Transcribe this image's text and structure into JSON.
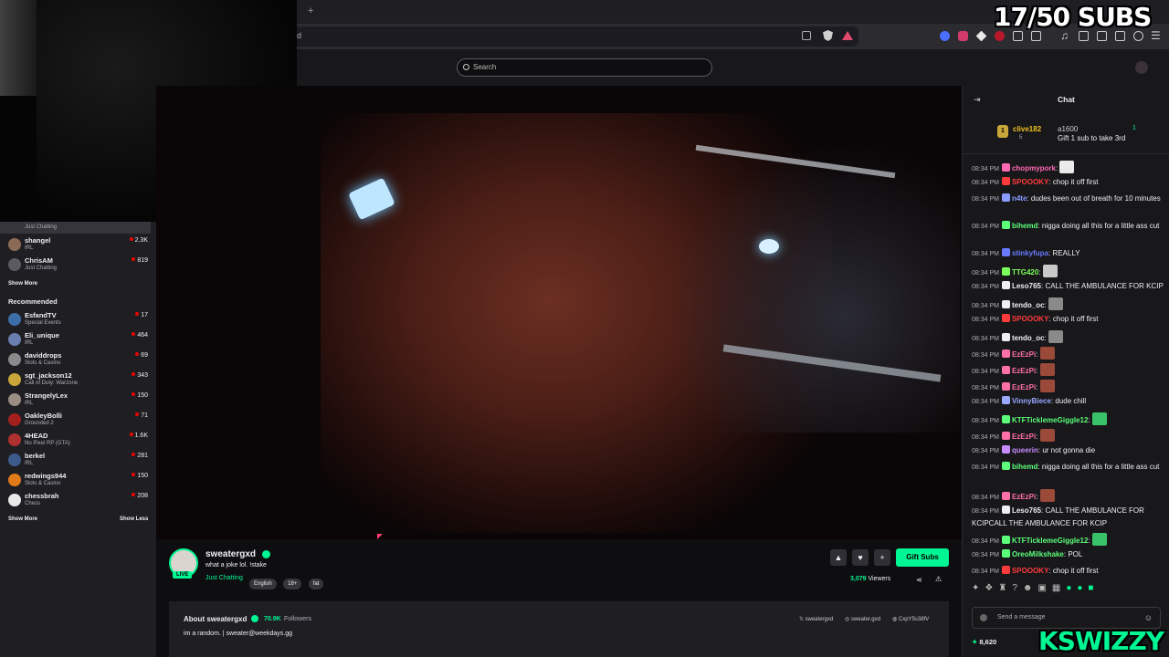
{
  "overlay": {
    "subs_goal": "17/50 SUBS",
    "streamer_logo": "KSWIZZY"
  },
  "browser": {
    "new_tab": "+",
    "url_tail": "d"
  },
  "header": {
    "search_placeholder": "Search"
  },
  "sidebar": {
    "top_channels": [
      {
        "game": "Just Chatting"
      },
      {
        "name": "shangel",
        "game": "IRL",
        "viewers": "2.3K"
      },
      {
        "name": "ChrisAM",
        "game": "Just Chatting",
        "viewers": "819"
      }
    ],
    "show_more_1": "Show More",
    "recommended_title": "Recommended",
    "recommended": [
      {
        "name": "EsfandTV",
        "game": "Special Events",
        "viewers": "17"
      },
      {
        "name": "Eli_unique",
        "game": "IRL",
        "viewers": "464"
      },
      {
        "name": "daviddrops",
        "game": "Slots & Casino",
        "viewers": "69"
      },
      {
        "name": "sgt_jackson12",
        "game": "Call of Duty: Warzone",
        "viewers": "343"
      },
      {
        "name": "StrangelyLex",
        "game": "IRL",
        "viewers": "150"
      },
      {
        "name": "OakleyBolli",
        "game": "Grounded 2",
        "viewers": "71"
      },
      {
        "name": "4HEAD",
        "game": "No Pixel RP (GTA)",
        "viewers": "1.6K"
      },
      {
        "name": "berkel",
        "game": "IRL",
        "viewers": "281"
      },
      {
        "name": "redwings944",
        "game": "Slots & Casino",
        "viewers": "150"
      },
      {
        "name": "chessbrah",
        "game": "Chess",
        "viewers": "208"
      }
    ],
    "show_more_2": "Show More",
    "show_less": "Show Less"
  },
  "stream": {
    "live_badge": "LIVE",
    "channel": "sweatergxd",
    "title": "what a joke lol. !stake",
    "category": "Just Chatting",
    "tags": [
      "English",
      "18+",
      "fat"
    ],
    "gift_subs": "Gift Subs",
    "viewers": "3,079",
    "viewers_label": "Viewers"
  },
  "about": {
    "heading": "About sweatergxd",
    "followers": "70.9K",
    "followers_label": "Followers",
    "bio": "im a random. | sweater@weekdays.gg",
    "socials": [
      "sweatergxd",
      "sweater.gxd",
      "CxpY5s38fV"
    ]
  },
  "chat": {
    "title": "Chat",
    "leaderboard": [
      {
        "rank": "1",
        "name": "clive182",
        "sub": "5"
      },
      {
        "name": "a1600",
        "gift_count": "1",
        "note": "Gift 1 sub to take 3rd"
      }
    ],
    "messages": [
      {
        "time": "08:34 PM",
        "user": "chopmypork",
        "color": "#ff69b4",
        "text": ""
      },
      {
        "time": "08:34 PM",
        "user": "SPOOOKY",
        "color": "#ff3b3b",
        "text": "chop it off first"
      },
      {
        "time": "08:34 PM",
        "user": "n4te",
        "color": "#8a9cff",
        "text": "dudes been out of breath for 10 minutes"
      },
      {
        "time": "08:34 PM",
        "user": "bihemd",
        "color": "#5cff7a",
        "text": "nigga doing all this for a little ass cut"
      },
      {
        "time": "08:34 PM",
        "user": "stinkyfupa",
        "color": "#6a7aff",
        "text": "REALLY"
      },
      {
        "time": "08:34 PM",
        "user": "TTG420",
        "color": "#7cff5a",
        "text": ""
      },
      {
        "time": "08:34 PM",
        "user": "Leso765",
        "color": "#efeff1",
        "text": "CALL THE AMBULANCE FOR KCIP"
      },
      {
        "time": "08:34 PM",
        "user": "tendo_oc",
        "color": "#efeff1",
        "text": ""
      },
      {
        "time": "08:34 PM",
        "user": "SPOOOKY",
        "color": "#ff3b3b",
        "text": "chop it off first"
      },
      {
        "time": "08:34 PM",
        "user": "tendo_oc",
        "color": "#efeff1",
        "text": ""
      },
      {
        "time": "08:34 PM",
        "user": "EzEzPi",
        "color": "#ff6fa8",
        "text": ""
      },
      {
        "time": "08:34 PM",
        "user": "EzEzPi",
        "color": "#ff6fa8",
        "text": ""
      },
      {
        "time": "08:34 PM",
        "user": "EzEzPi",
        "color": "#ff6fa8",
        "text": ""
      },
      {
        "time": "08:34 PM",
        "user": "VinnyBiece",
        "color": "#9aa8ff",
        "text": "dude chill"
      },
      {
        "time": "08:34 PM",
        "user": "KTFTicklemeGiggle12",
        "color": "#5cff7a",
        "text": ""
      },
      {
        "time": "08:34 PM",
        "user": "EzEzPi",
        "color": "#ff6fa8",
        "text": ""
      },
      {
        "time": "08:34 PM",
        "user": "queerin",
        "color": "#c78bff",
        "text": "ur not gonna die"
      },
      {
        "time": "08:34 PM",
        "user": "bihemd",
        "color": "#5cff7a",
        "text": "nigga doing all this for a little ass cut"
      },
      {
        "time": "08:34 PM",
        "user": "EzEzPi",
        "color": "#ff6fa8",
        "text": ""
      },
      {
        "time": "08:34 PM",
        "user": "Leso765",
        "color": "#efeff1",
        "text": "CALL THE AMBULANCE FOR KCIPCALL THE AMBULANCE FOR KCIP"
      },
      {
        "time": "08:34 PM",
        "user": "KTFTicklemeGiggle12",
        "color": "#5cff7a",
        "text": ""
      },
      {
        "time": "08:34 PM",
        "user": "OreoMilkshake",
        "color": "#5cff7a",
        "text": "POL"
      },
      {
        "time": "08:34 PM",
        "user": "SPOOOKY",
        "color": "#ff3b3b",
        "text": "chop it off first"
      }
    ],
    "input_placeholder": "Send a message",
    "points": "8,620"
  },
  "colors": {
    "accent": "#00f593",
    "live": "#eb0400",
    "bg": "#0e0e10",
    "panel": "#18181b"
  }
}
